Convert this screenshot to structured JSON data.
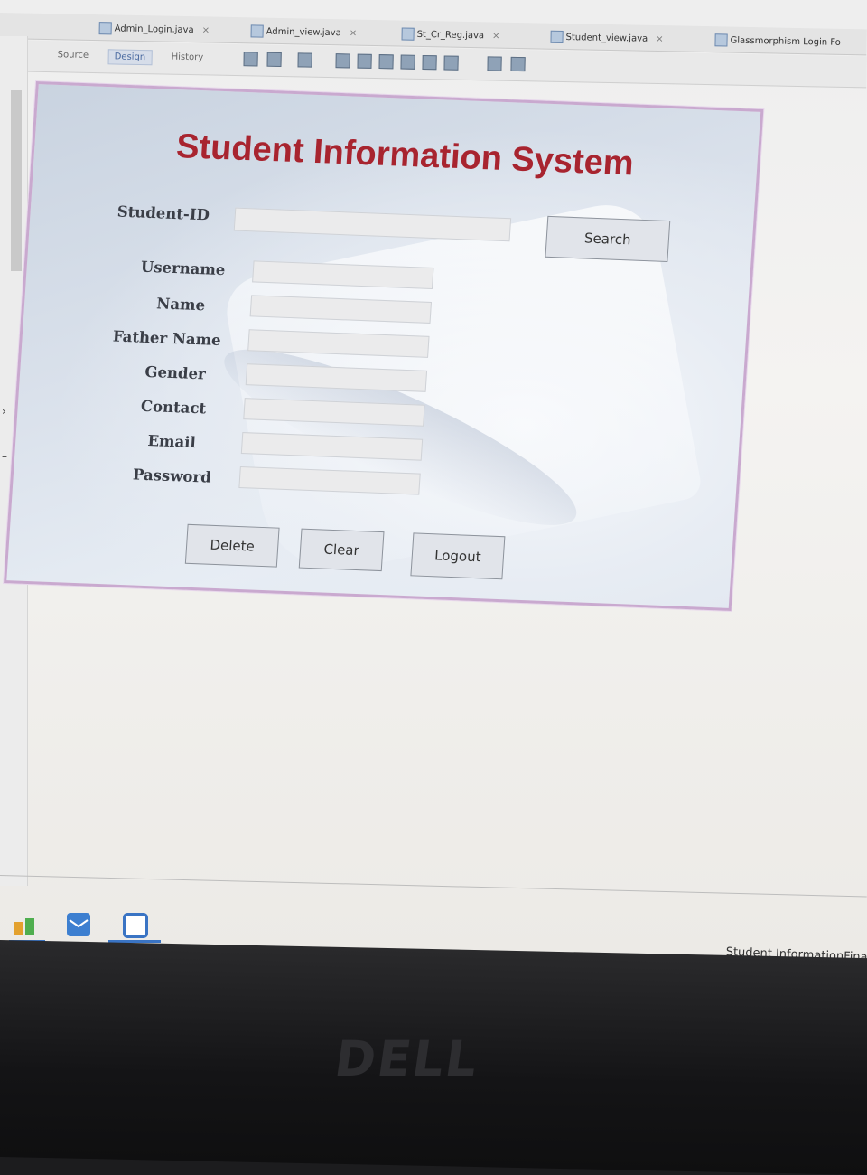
{
  "ide": {
    "tabs": [
      {
        "label": "Admin_Login.java"
      },
      {
        "label": "Admin_view.java"
      },
      {
        "label": "St_Cr_Reg.java"
      },
      {
        "label": "Student_view.java"
      },
      {
        "label": "Glassmorphism Login Fo"
      }
    ],
    "close_glyph": "×",
    "view_buttons": {
      "source": "Source",
      "design": "Design",
      "history": "History"
    },
    "toolbar_icons": [
      "selection-mode-icon",
      "connection-mode-icon",
      "preview-design-icon",
      "align-left-icon",
      "align-right-icon",
      "center-horizontal-icon",
      "align-top-icon",
      "align-bottom-icon",
      "center-vertical-icon",
      "resize-width-icon",
      "resize-height-icon"
    ]
  },
  "form": {
    "title": "Student Information System",
    "student_id_label": "Student-ID",
    "search_button": "Search",
    "labels": {
      "username": "Username",
      "name": "Name",
      "father_name": "Father Name",
      "gender": "Gender",
      "contact": "Contact",
      "email": "Email",
      "password": "Password"
    },
    "buttons": {
      "delete": "Delete",
      "clear": "Clear",
      "logout": "Logout"
    },
    "colors": {
      "title": "#a8242f",
      "frame_border": "#c9a9cf"
    }
  },
  "statusbar": {
    "project": "Student InformationFina"
  },
  "monitor": {
    "brand": "DELL"
  }
}
